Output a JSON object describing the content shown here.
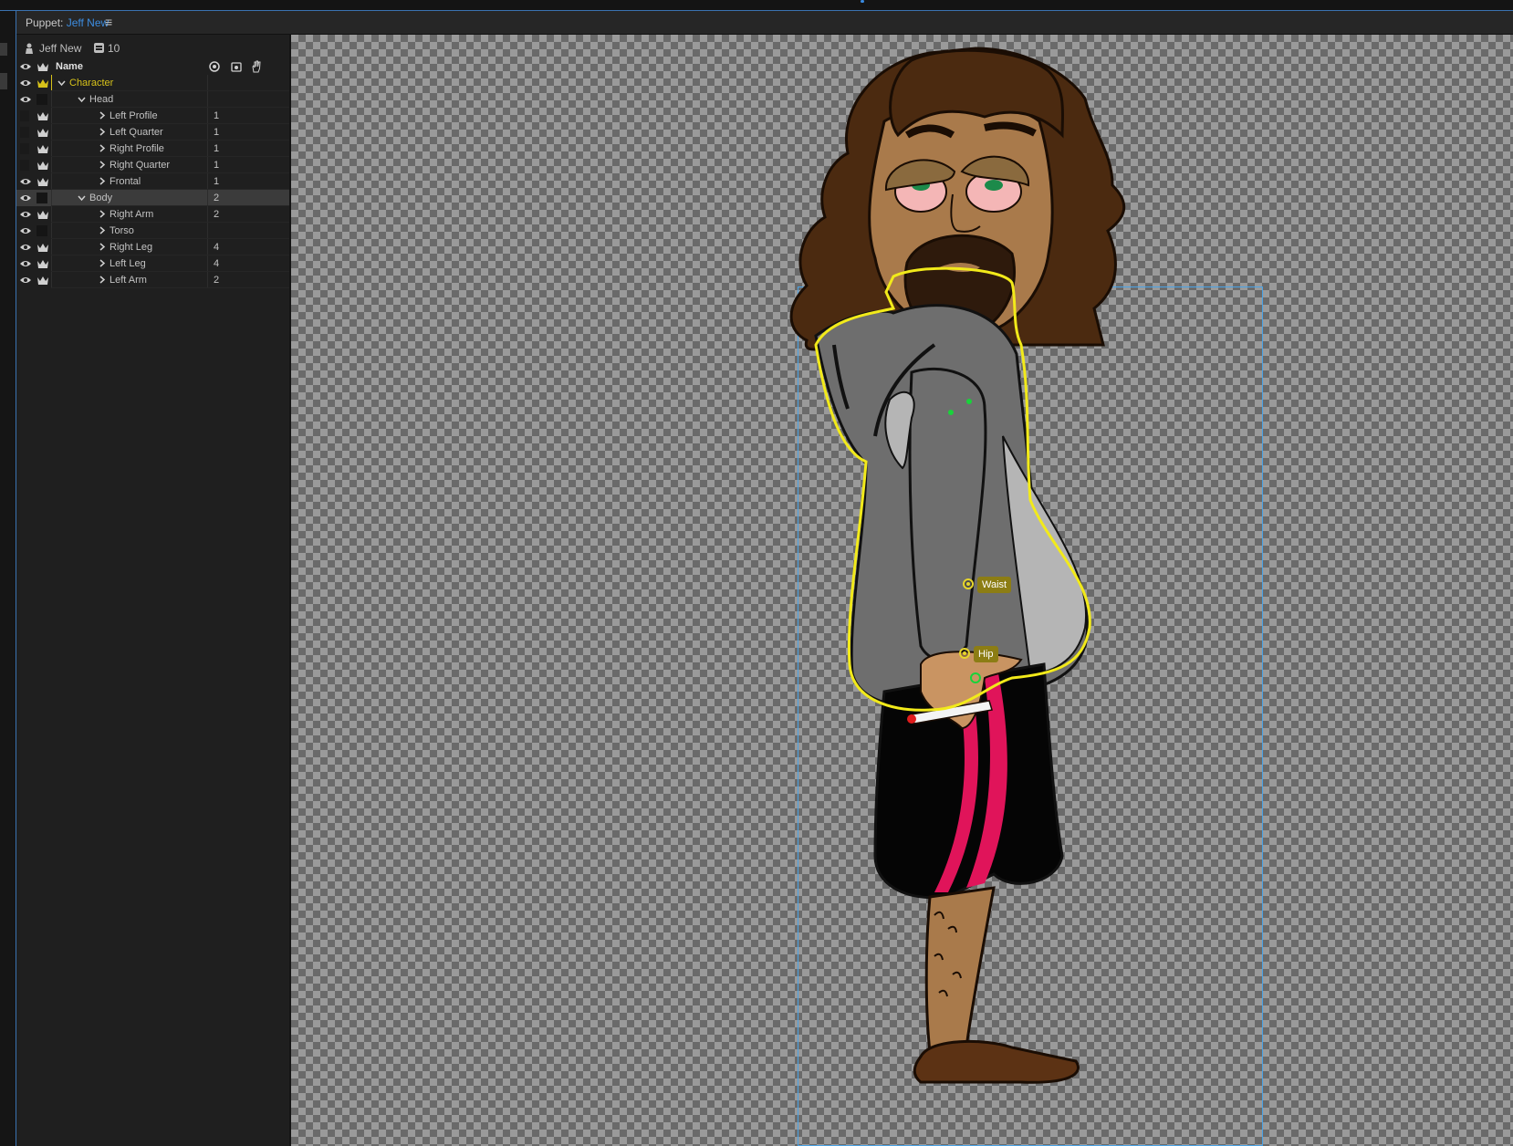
{
  "panel": {
    "label": "Puppet:",
    "puppet_name": "Jeff New",
    "menu_glyph": "≡"
  },
  "puppet": {
    "name": "Jeff New",
    "count": "10"
  },
  "columns": {
    "name": "Name"
  },
  "layers": [
    {
      "name": "Character",
      "count": ""
    },
    {
      "name": "Head",
      "count": ""
    },
    {
      "name": "Left Profile",
      "count": "1"
    },
    {
      "name": "Left Quarter",
      "count": "1"
    },
    {
      "name": "Right Profile",
      "count": "1"
    },
    {
      "name": "Right Quarter",
      "count": "1"
    },
    {
      "name": "Frontal",
      "count": "1"
    },
    {
      "name": "Body",
      "count": "2"
    },
    {
      "name": "Right Arm",
      "count": "2"
    },
    {
      "name": "Torso",
      "count": ""
    },
    {
      "name": "Right Leg",
      "count": "4"
    },
    {
      "name": "Left Leg",
      "count": "4"
    },
    {
      "name": "Left Arm",
      "count": "2"
    }
  ],
  "handles": {
    "waist": "Waist",
    "hip": "Hip"
  },
  "colors": {
    "accent": "#3d8de0",
    "highlight": "#d7c21a",
    "outline": "#f2ea1a",
    "bbox": "#4aa3e6"
  }
}
